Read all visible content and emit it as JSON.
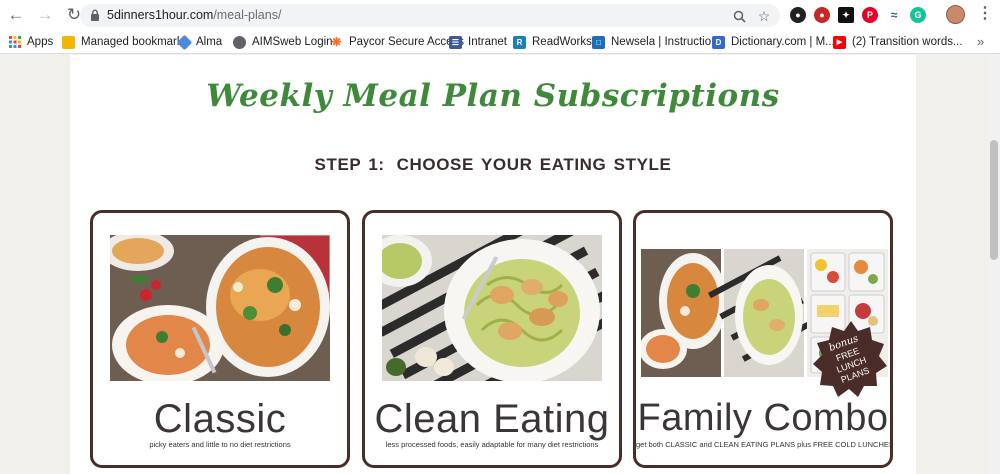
{
  "browser": {
    "url_domain": "5dinners1hour.com",
    "url_path": "/meal-plans/",
    "bookmarks": [
      {
        "label": "Apps",
        "icon": "apps-grid-icon",
        "color": "#4285f4"
      },
      {
        "label": "Managed bookmarks",
        "icon": "folder-icon",
        "color": "#f2b500"
      },
      {
        "label": "Alma",
        "icon": "alma-icon",
        "color": "#4e8cd9"
      },
      {
        "label": "AIMSweb Login",
        "icon": "globe-icon",
        "color": "#5f6368"
      },
      {
        "label": "Paycor Secure Access",
        "icon": "paycor-icon",
        "color": "#f26b21"
      },
      {
        "label": "Intranet",
        "icon": "intranet-icon",
        "color": "#3d5a98"
      },
      {
        "label": "ReadWorks",
        "icon": "readworks-icon",
        "color": "#1a7fb5"
      },
      {
        "label": "Newsela | Instructio...",
        "icon": "newsela-icon",
        "color": "#1b6fb8"
      },
      {
        "label": "Dictionary.com | M...",
        "icon": "dictionary-icon",
        "color": "#3367d6"
      },
      {
        "label": "(2) Transition words...",
        "icon": "youtube-icon",
        "color": "#ff0000"
      }
    ]
  },
  "page": {
    "headline": "Weekly Meal Plan Subscriptions",
    "step_label": "STEP 1:",
    "step_text": "CHOOSE YOUR EATING STYLE",
    "plans": [
      {
        "title": "Classic",
        "subtitle": "picky eaters and little to no diet restrictions"
      },
      {
        "title": "Clean Eating",
        "subtitle": "less processed foods, easily adaptable for many diet restrictions"
      },
      {
        "title": "Family Combo",
        "subtitle": "get both CLASSIC and CLEAN EATING PLANS plus FREE COLD LUNCHES",
        "badge": [
          "bonus",
          "FREE",
          "LUNCH",
          "PLANS"
        ]
      }
    ]
  },
  "colors": {
    "headline_green": "#3f8a3a",
    "card_border": "#4a2c28",
    "badge_brown": "#4a2c28"
  }
}
